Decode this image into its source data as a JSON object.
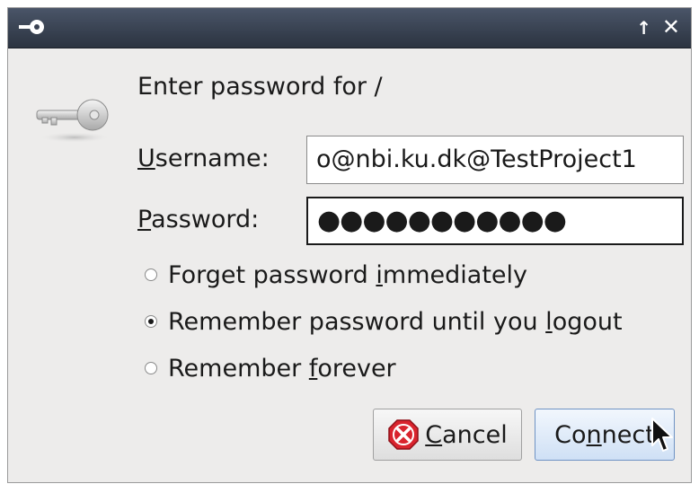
{
  "window": {
    "up_glyph": "↑",
    "close_glyph": "✕"
  },
  "dialog": {
    "prompt": "Enter password for /",
    "username": {
      "label_mnemonic": "U",
      "label_rest": "sername:",
      "value": "o@nbi.ku.dk@TestProject1"
    },
    "password": {
      "label_mnemonic": "P",
      "label_rest": "assword:",
      "value": "●●●●●●●●●●●"
    },
    "options": [
      {
        "before": "Forget password ",
        "mnemonic": "i",
        "after": "mmediately",
        "checked": false
      },
      {
        "before": "Remember password until you ",
        "mnemonic": "l",
        "after": "ogout",
        "checked": true
      },
      {
        "before": "Remember ",
        "mnemonic": "f",
        "after": "orever",
        "checked": false
      }
    ],
    "buttons": {
      "cancel": {
        "mnemonic": "C",
        "rest": "ancel"
      },
      "connect": {
        "before": "Co",
        "mnemonic": "n",
        "after": "nect"
      }
    }
  },
  "colors": {
    "titlebar": "#2b3340",
    "dialog_bg": "#edeceb",
    "cancel_icon": "#d9232d",
    "default_button": "#cfe0f5"
  },
  "icons": [
    "key-icon",
    "cancel-icon",
    "mouse-cursor-icon"
  ]
}
